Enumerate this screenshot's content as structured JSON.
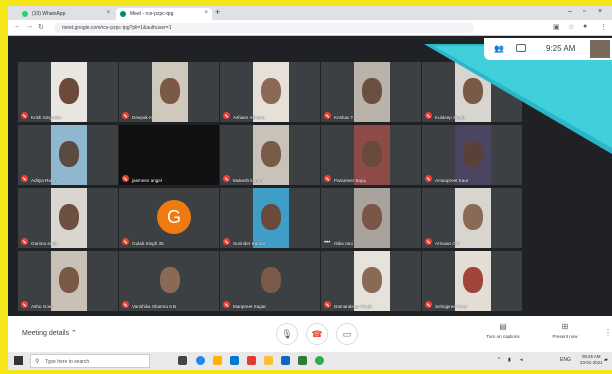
{
  "browser": {
    "tabs": [
      {
        "title": "(10) WhatsApp",
        "favicon_color": "#25d366"
      },
      {
        "title": "Meet - rce-pzpc-tpg",
        "favicon_color": "#00897b"
      }
    ],
    "url": "meet.google.com/rce-pzpc-tpg?pli=1&authuser=1"
  },
  "overlay": {
    "clock": "9:25 AM"
  },
  "tiles": [
    {
      "name": "Krish Singroha",
      "kind": "video",
      "bg": "#e9e6e1",
      "face": "#6b4a3a"
    },
    {
      "name": "Deepak K",
      "kind": "video",
      "bg": "#cfc8bd",
      "face": "#7a5a44"
    },
    {
      "name": "Ashiam Ashiam",
      "kind": "video",
      "bg": "#e7e0d8",
      "face": "#8a6a55"
    },
    {
      "name": "Keshav T",
      "kind": "video",
      "bg": "#b9b3a9",
      "face": "#6a5040"
    },
    {
      "name": "Kuldeep Singh",
      "kind": "video",
      "bg": "#d8d4cf",
      "face": "#7a5a45"
    },
    {
      "name": "Aditya Rawat",
      "kind": "video",
      "bg": "#8fb7cf",
      "face": "#5a4a40"
    },
    {
      "name": "jasmeen angel",
      "kind": "black"
    },
    {
      "name": "Mukesh kumar",
      "kind": "video",
      "bg": "#c9c2b8",
      "face": "#7a5a48"
    },
    {
      "name": "Parameer Bajaj",
      "kind": "video",
      "bg": "#8f4a4a",
      "face": "#6a4a3a"
    },
    {
      "name": "Amanpreet Kaur",
      "kind": "video",
      "bg": "#4a4560",
      "face": "#5a4038"
    },
    {
      "name": "Garima singh",
      "kind": "video",
      "bg": "#d9d6cf",
      "face": "#6e5040"
    },
    {
      "name": "Gulab Singh 35",
      "kind": "avatar",
      "initial": "G"
    },
    {
      "name": "Surinder Kumar",
      "kind": "video",
      "bg": "#3e9ec7",
      "face": "#6a4a3a"
    },
    {
      "name": "ritika rani",
      "kind": "video",
      "bg": "#a8a39c",
      "face": "#7a5548",
      "dots": true
    },
    {
      "name": "Armaan Giri",
      "kind": "video",
      "bg": "#d8d4ce",
      "face": "#8a6a55"
    },
    {
      "name": "Ashu Goel",
      "kind": "video",
      "bg": "#c9c0b6",
      "face": "#7a5a45"
    },
    {
      "name": "Vanshika Sharma 6 B",
      "kind": "video",
      "bg": "#3c4043",
      "face": "#8a6a55"
    },
    {
      "name": "Manpreet Sagar",
      "kind": "video",
      "bg": "#3c4043",
      "face": "#7a5a48"
    },
    {
      "name": "Damandeep Singh",
      "kind": "video",
      "bg": "#e6e2dc",
      "face": "#8a6a55"
    },
    {
      "name": "Sehajpreet kaur",
      "kind": "video",
      "bg": "#e3ddd5",
      "face": "#a0453a"
    }
  ],
  "bottombar": {
    "meeting_details": "Meeting details",
    "captions_label": "Turn on captions",
    "present_label": "Present now"
  },
  "taskbar": {
    "search_placeholder": "Type here to search",
    "lang": "ENG",
    "time": "09:25 AM",
    "date": "23-01-2021"
  }
}
